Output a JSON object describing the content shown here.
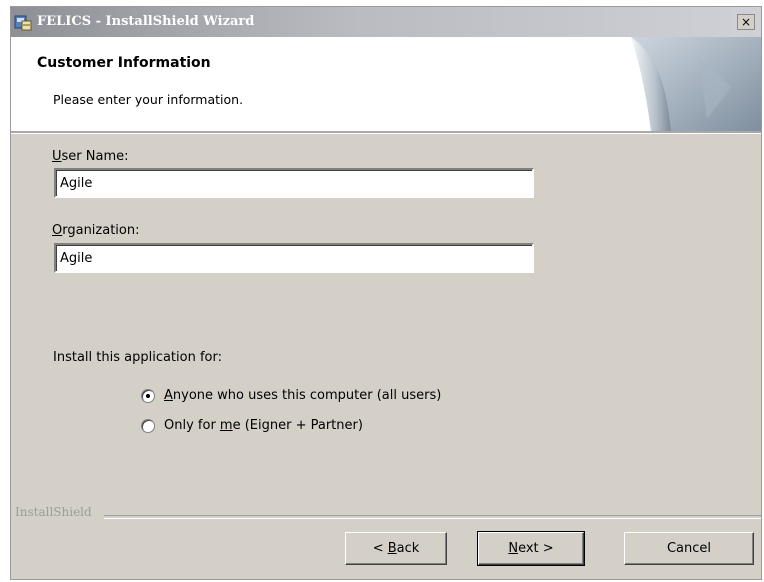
{
  "window": {
    "title": "FELICS - InstallShield Wizard",
    "close_label": "×"
  },
  "banner": {
    "title": "Customer Information",
    "subtitle": "Please enter your information."
  },
  "form": {
    "username": {
      "label_key": "U",
      "label_rest": "ser Name:",
      "value": "Agile"
    },
    "organization": {
      "label_key": "O",
      "label_rest": "rganization:",
      "value": "Agile"
    },
    "install_for_label": "Install this application for:",
    "options": [
      {
        "key": "A",
        "rest": "nyone who uses this computer (all users)",
        "selected": true
      },
      {
        "pre": "Only for ",
        "key": "m",
        "post": "e (Eigner + Partner)",
        "selected": false
      }
    ]
  },
  "footer": {
    "brand": "InstallShield",
    "back": {
      "pre": "< ",
      "key": "B",
      "post": "ack"
    },
    "next": {
      "key": "N",
      "post": "ext >"
    },
    "cancel": "Cancel"
  }
}
